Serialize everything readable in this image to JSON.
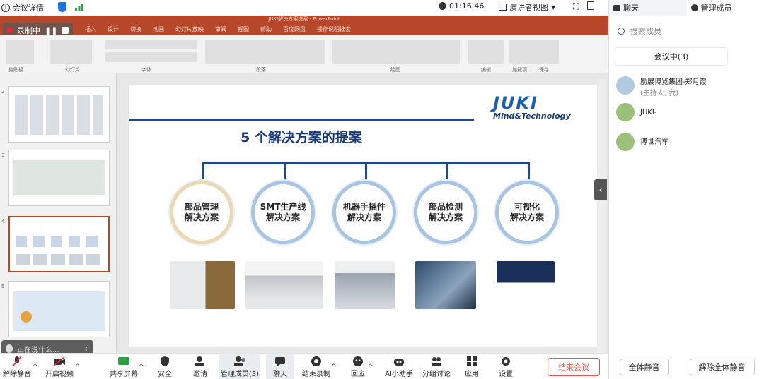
{
  "meeting": {
    "info_label": "会议详情",
    "timer": "01:16:46",
    "view_label": "演讲者视图"
  },
  "right_panel": {
    "tab_chat": "聊天",
    "tab_members": "管理成员",
    "search_placeholder": "搜索成员",
    "status": "会议中(3)",
    "members": [
      {
        "name": "励展博览集团-郑月霞",
        "sub": "(主持人, 我)"
      },
      {
        "name": "JUKI-",
        "sub": ""
      },
      {
        "name": "博世汽车",
        "sub": ""
      }
    ],
    "mute_all": "全体静音",
    "unmute_all": "解除全体静音"
  },
  "ppt": {
    "title": "JUKI解决方案提案 - PowerPoint",
    "recording": "录制中",
    "menu": [
      "插入",
      "设计",
      "切换",
      "动画",
      "幻灯片放映",
      "审阅",
      "视图",
      "帮助",
      "百度网盘"
    ],
    "tell_me": "操作说明搜索",
    "ribbon_groups": [
      "剪贴板",
      "幻灯片",
      "字体",
      "段落",
      "绘图",
      "编辑",
      "加载项",
      "保存"
    ],
    "thumbnail_numbers": [
      "2",
      "3",
      "4",
      "5"
    ],
    "tooltip": "正在说什么..."
  },
  "slide": {
    "logo_main": "JUKI",
    "logo_sub": "Mind&Technology",
    "title": "5 个解决方案的提案",
    "solutions": [
      {
        "line1": "部品管理",
        "line2": "解决方案"
      },
      {
        "line1": "SMT生产线",
        "line2": "解决方案"
      },
      {
        "line1": "机器手插件",
        "line2": "解决方案"
      },
      {
        "line1": "部品检测",
        "line2": "解决方案"
      },
      {
        "line1": "可视化",
        "line2": "解决方案"
      }
    ]
  },
  "toolbar": {
    "unmute": "解除静音",
    "video": "开启视频",
    "share": "共享屏幕",
    "security": "安全",
    "invite": "邀请",
    "members": "管理成员(3)",
    "chat": "聊天",
    "end_record": "结束录制",
    "reactions": "回应",
    "ai": "AI小助手",
    "breakout": "分组讨论",
    "apps": "应用",
    "settings": "设置",
    "end_meeting": "结束会议"
  },
  "colors": {
    "ppt_accent": "#b7472a",
    "slide_blue": "#1f4a8a",
    "end_red": "#e05a4a"
  }
}
